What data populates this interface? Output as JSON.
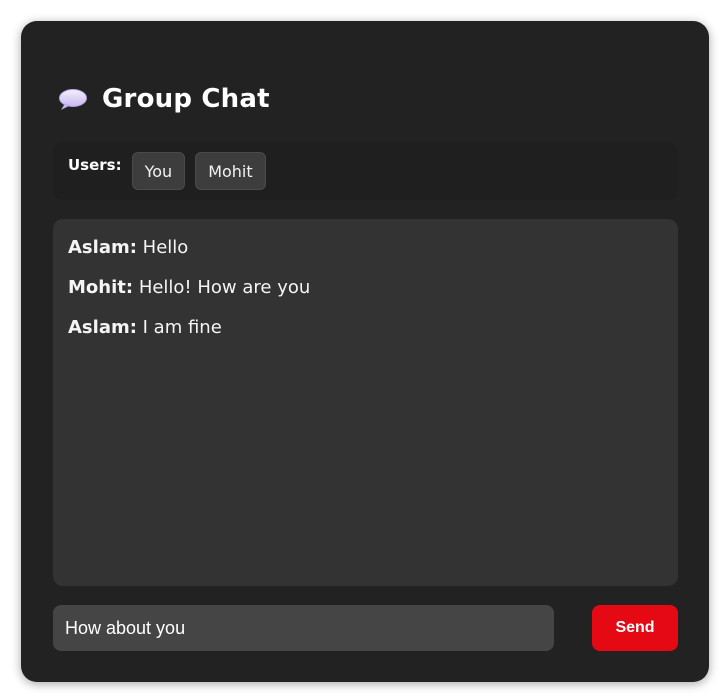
{
  "header": {
    "icon": "speech-bubble-icon",
    "title": "Group Chat"
  },
  "users": {
    "label": "Users:",
    "list": [
      "You",
      "Mohit"
    ]
  },
  "messages": [
    {
      "sender": "Aslam:",
      "text": "Hello"
    },
    {
      "sender": "Mohit:",
      "text": "Hello! How are you"
    },
    {
      "sender": "Aslam:",
      "text": "I am fine"
    }
  ],
  "composer": {
    "value": "How about you",
    "send_label": "Send"
  },
  "colors": {
    "background": "#222222",
    "panel": "#333333",
    "input": "#454545",
    "accent": "#e50914"
  }
}
